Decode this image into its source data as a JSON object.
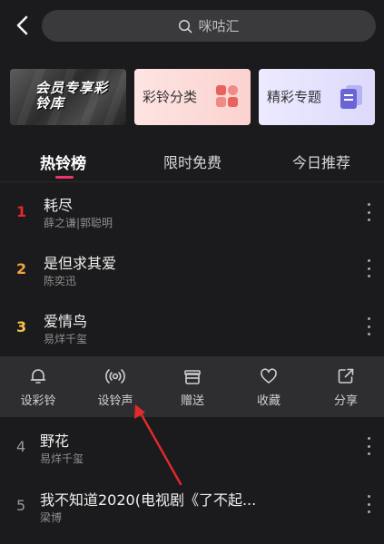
{
  "search": {
    "placeholder": "咪咕汇"
  },
  "cards": {
    "vip": {
      "label": "会员专享彩铃库"
    },
    "category": {
      "label": "彩铃分类"
    },
    "topic": {
      "label": "精彩专题"
    }
  },
  "tabs": [
    {
      "label": "热铃榜"
    },
    {
      "label": "限时免费"
    },
    {
      "label": "今日推荐"
    }
  ],
  "songs": [
    {
      "rank": "1",
      "title": "耗尽",
      "artist": "薛之谦|郭聪明"
    },
    {
      "rank": "2",
      "title": "是但求其爱",
      "artist": "陈奕迅"
    },
    {
      "rank": "3",
      "title": "爱情鸟",
      "artist": "易烊千玺"
    },
    {
      "rank": "4",
      "title": "野花",
      "artist": "易烊千玺"
    },
    {
      "rank": "5",
      "title": "我不知道2020(电视剧《了不起...",
      "artist": "梁博"
    }
  ],
  "actions": [
    {
      "label": "设彩铃",
      "icon": "bell-icon"
    },
    {
      "label": "设铃声",
      "icon": "ringtone-icon"
    },
    {
      "label": "赠送",
      "icon": "gift-icon"
    },
    {
      "label": "收藏",
      "icon": "heart-icon"
    },
    {
      "label": "分享",
      "icon": "share-icon"
    }
  ],
  "colors": {
    "rank1": "#e3262b",
    "rank2": "#f2a33a",
    "rank3": "#f6c34a",
    "rank_other": "#9a9a9a",
    "accent": "#f0326a",
    "arrow": "#e32a2a"
  }
}
